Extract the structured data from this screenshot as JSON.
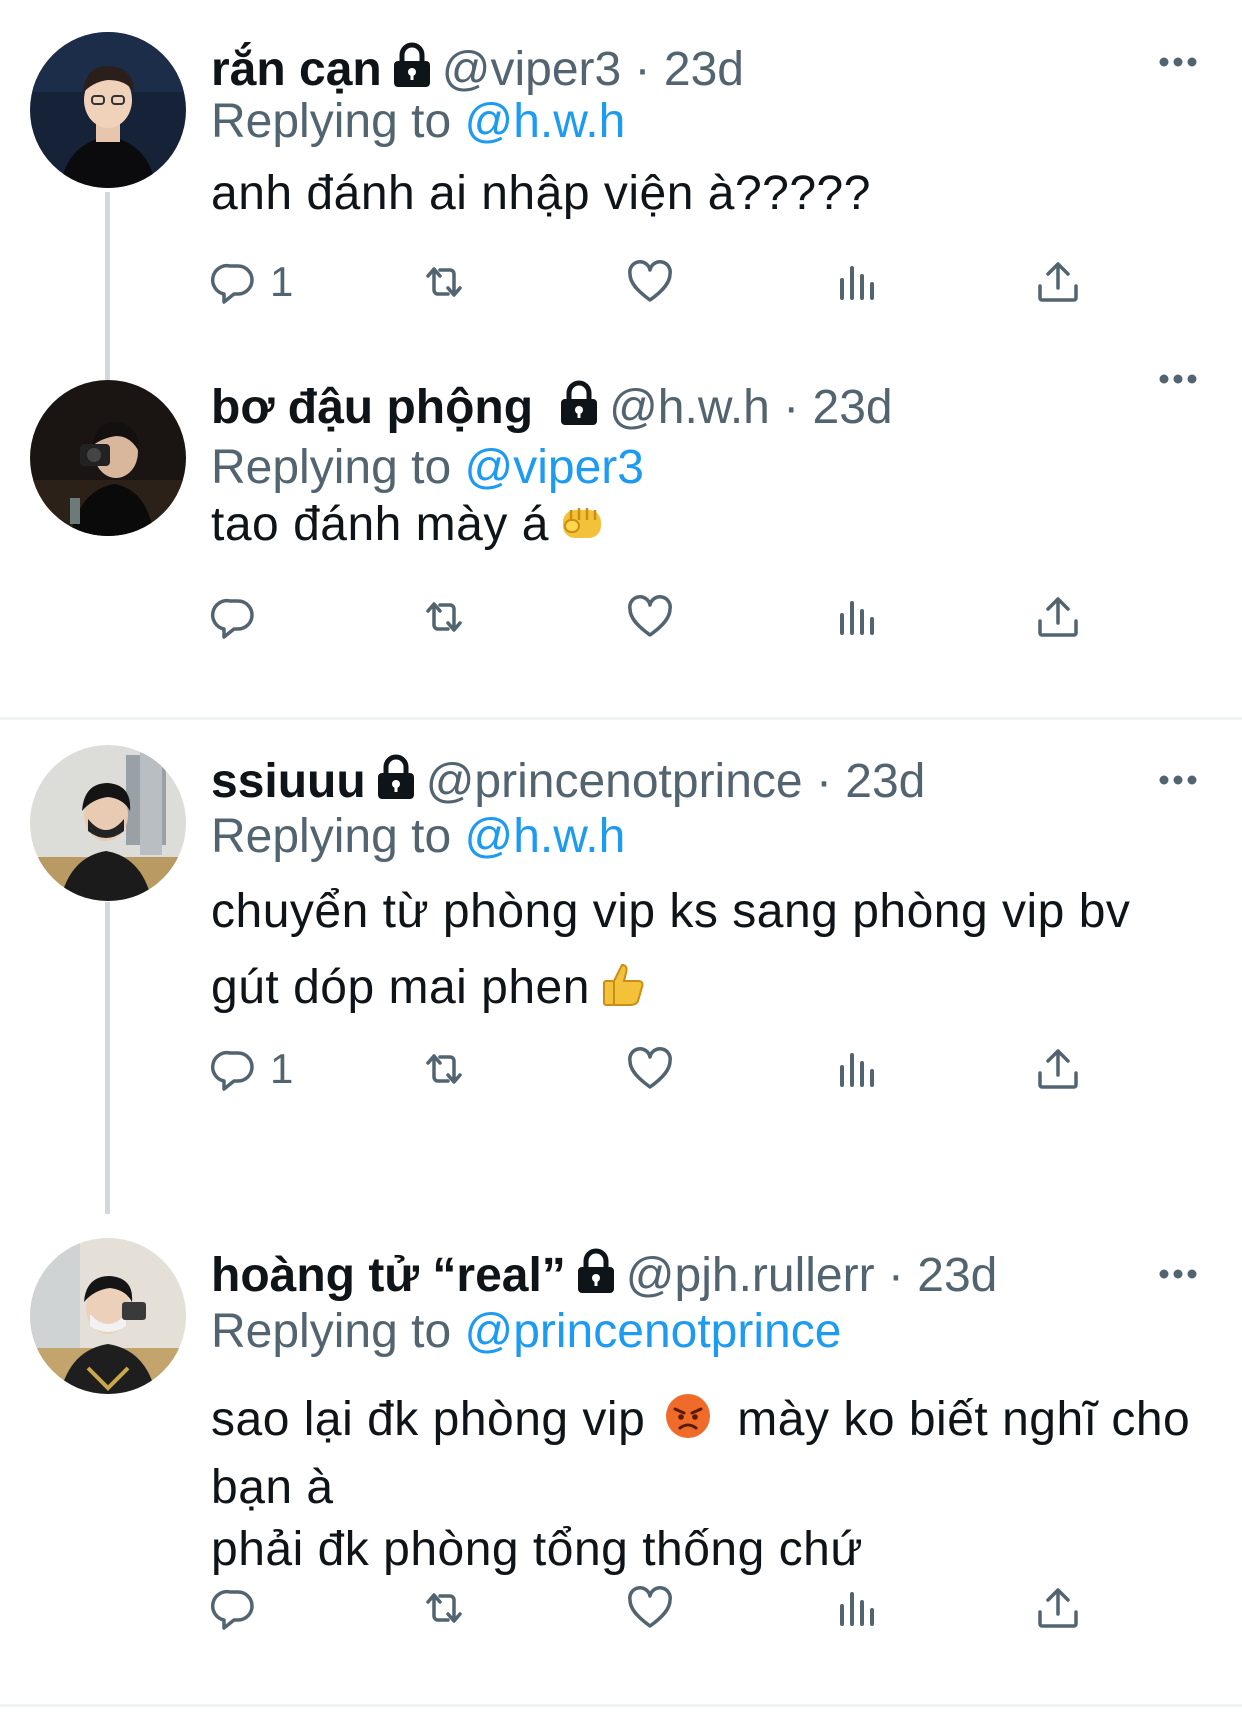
{
  "tweets": [
    {
      "name": "rắn cạn",
      "handle": "@viper3",
      "sep": " · ",
      "time": "23d",
      "replying_prefix": "Replying to ",
      "replying_to": "@h.w.h",
      "body": [
        "anh đánh ai nhập viện à?????"
      ],
      "reply_count": "1"
    },
    {
      "name": "bơ đậu phộng",
      "handle": "@h.w.h",
      "sep": " · ",
      "time": "23d",
      "replying_prefix": "Replying to ",
      "replying_to": "@viper3",
      "body": [
        "tao đánh mày á"
      ],
      "emoji": "oncoming-fist",
      "reply_count": ""
    },
    {
      "name": "ssiuuu",
      "handle": "@princenotprince",
      "sep": " · ",
      "time": "23d",
      "replying_prefix": "Replying to ",
      "replying_to": "@h.w.h",
      "body": [
        "chuyển từ phòng vip ks sang phòng vip bv",
        "gút dóp mai phen"
      ],
      "emoji": "thumbs-up",
      "reply_count": "1"
    },
    {
      "name": "hoàng tử “real”",
      "handle": "@pjh.rullerr",
      "sep": " · ",
      "time": "23d",
      "replying_prefix": "Replying to ",
      "replying_to": "@princenotprince",
      "body": [
        "sao lại đk phòng vip",
        "mày ko biết nghĩ cho bạn à",
        "phải đk phòng tổng thống chứ"
      ],
      "emoji": "angry-face",
      "reply_count": ""
    }
  ],
  "colors": {
    "text": "#0f1419",
    "muted": "#536471",
    "link": "#1d9bf0",
    "thread_line": "#cfd9de",
    "divider": "#eff3f4"
  }
}
